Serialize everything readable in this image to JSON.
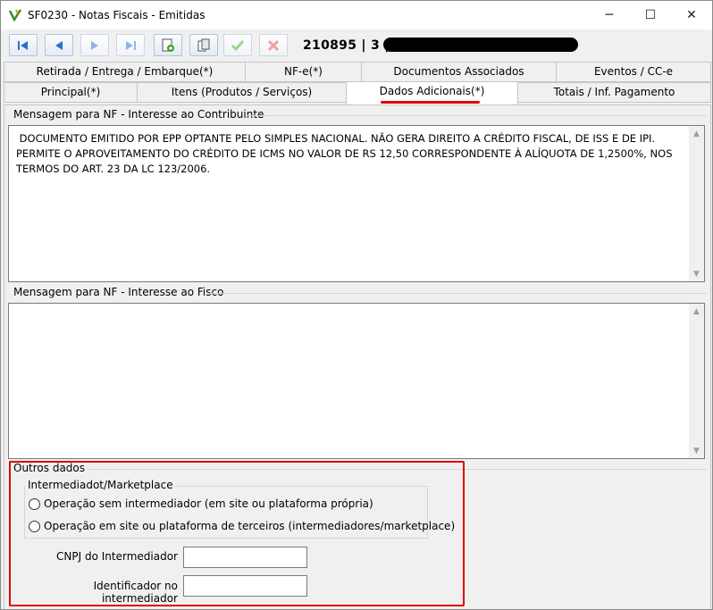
{
  "window": {
    "title": "SF0230 - Notas Fiscais - Emitidas",
    "controls": {
      "minimize": "─",
      "maximize": "☐",
      "close": "✕"
    }
  },
  "toolbar": {
    "record_id": "210895 | 3 |",
    "buttons": [
      "first-record-icon",
      "previous-record-icon",
      "next-record-icon",
      "last-record-icon",
      "new-record-icon",
      "copy-record-icon",
      "confirm-icon",
      "cancel-icon"
    ]
  },
  "tabs": {
    "row1": [
      "Retirada / Entrega / Embarque(*)",
      "NF-e(*)",
      "Documentos Associados",
      "Eventos / CC-e"
    ],
    "row2": [
      "Principal(*)",
      "Itens (Produtos / Serviços)",
      "Dados Adicionais(*)",
      "Totais / Inf. Pagamento"
    ],
    "active": "Dados Adicionais(*)"
  },
  "contribuinte": {
    "label": "Mensagem para NF - Interesse ao Contribuinte",
    "text": " DOCUMENTO EMITIDO POR EPP OPTANTE PELO SIMPLES NACIONAL. NÃO GERA DIREITO A CRÉDITO FISCAL, DE ISS E DE IPI.\nPERMITE O APROVEITAMENTO DO CRÉDITO DE ICMS NO VALOR DE RS 12,50 CORRESPONDENTE À ALÍQUOTA DE 1,2500%, NOS TERMOS DO ART. 23 DA LC 123/2006."
  },
  "fisco": {
    "label": "Mensagem para NF - Interesse ao Fisco",
    "text": ""
  },
  "outros": {
    "label": "Outros dados",
    "intermediador": {
      "label": "Intermediadot/Marketplace",
      "options": [
        "Operação sem intermediador (em site ou plataforma própria)",
        "Operação em site ou plataforma de terceiros (intermediadores/marketplace)"
      ]
    },
    "cnpj_label": "CNPJ do Intermediador",
    "cnpj_value": "",
    "identificador_label": "Identificador no intermediador",
    "identificador_value": ""
  },
  "colors": {
    "highlight": "#e00000",
    "accent": "#1e6fd0"
  }
}
